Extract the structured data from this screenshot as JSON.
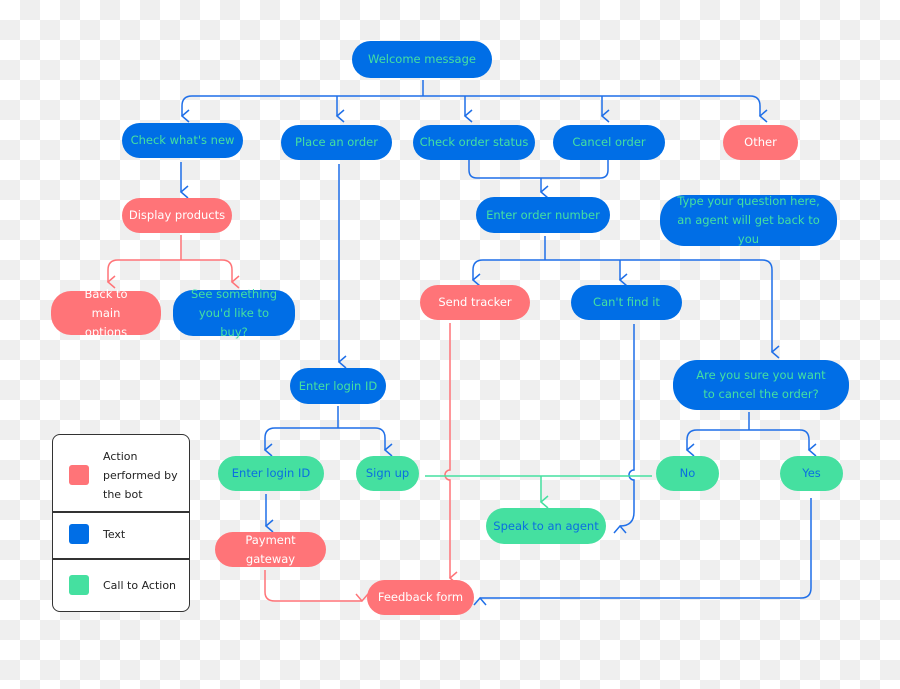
{
  "colors": {
    "action": "#ff7478",
    "text": "#006ee6",
    "cta": "#45e0a0"
  },
  "nodes": {
    "welcome": "Welcome message",
    "check_new": "Check what's new",
    "place_order": "Place an order",
    "check_status": "Check order status",
    "cancel_order": "Cancel order",
    "other": "Other",
    "display_products": "Display products",
    "back_main": "Back to main options",
    "see_something": "See something you'd like to buy?",
    "enter_order": "Enter order number",
    "type_question": "Type your question here, an agent will get back to you",
    "send_tracker": "Send tracker",
    "cant_find": "Can't find it",
    "are_you_sure": "Are you sure you want to cancel the order?",
    "enter_login_top": "Enter login ID",
    "enter_login2": "Enter login ID",
    "sign_up": "Sign up",
    "no": "No",
    "yes": "Yes",
    "speak_agent": "Speak to an agent",
    "payment": "Payment gateway",
    "feedback": "Feedback form"
  },
  "legend": [
    {
      "label": "Action performed by the bot",
      "color": "#ff7478"
    },
    {
      "label": "Text",
      "color": "#006ee6"
    },
    {
      "label": "Call to Action",
      "color": "#45e0a0"
    }
  ]
}
